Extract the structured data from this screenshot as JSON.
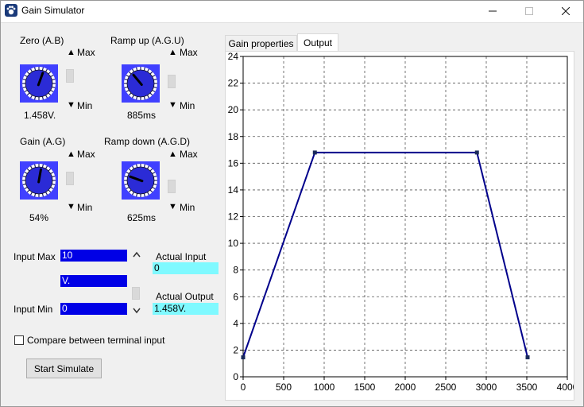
{
  "window": {
    "title": "Gain Simulator",
    "icon": "paw-icon",
    "controls": [
      "minimize",
      "maximize",
      "close"
    ]
  },
  "knobs": [
    {
      "id": "zero",
      "title": "Zero (A.B)",
      "value": "1.458V.",
      "max_label": "Max",
      "min_label": "Min"
    },
    {
      "id": "ramp_up",
      "title": "Ramp up (A.G.U)",
      "value": "885ms",
      "max_label": "Max",
      "min_label": "Min"
    },
    {
      "id": "gain",
      "title": "Gain (A.G)",
      "value": "54%",
      "max_label": "Max",
      "min_label": "Min"
    },
    {
      "id": "ramp_down",
      "title": "Ramp down (A.G.D)",
      "value": "625ms",
      "max_label": "Max",
      "min_label": "Min"
    }
  ],
  "inputs": {
    "input_max_label": "Input Max",
    "input_max_value": "10",
    "unit_value": "V.",
    "input_min_label": "Input Min",
    "input_min_value": "0"
  },
  "actual": {
    "input_label": "Actual Input",
    "input_value": "0",
    "output_label": "Actual Output",
    "output_value": "1.458V."
  },
  "compare_label": "Compare between terminal input",
  "compare_checked": false,
  "start_button": "Start Simulate",
  "tabs": [
    {
      "label": "Gain properties",
      "active": false
    },
    {
      "label": "Output",
      "active": true
    }
  ],
  "colors": {
    "knob_bg": "#4040ff",
    "knob_face": "#2b2bd6",
    "field_bg": "#0000e6",
    "cyan_bg": "#7ff9ff",
    "line": "#00008b"
  },
  "chart_data": {
    "type": "line",
    "title": "",
    "xlabel": "",
    "ylabel": "",
    "xlim": [
      0,
      4000
    ],
    "ylim": [
      0,
      24
    ],
    "xticks": [
      0,
      500,
      1000,
      1500,
      2000,
      2500,
      3000,
      3500,
      4000
    ],
    "yticks": [
      0,
      2,
      4,
      6,
      8,
      10,
      12,
      14,
      16,
      18,
      20,
      22,
      24
    ],
    "grid": true,
    "grid_style": "dashed",
    "series": [
      {
        "x": [
          0,
          885,
          2885,
          3510
        ],
        "y": [
          1.458,
          16.8,
          16.8,
          1.458
        ]
      }
    ]
  }
}
